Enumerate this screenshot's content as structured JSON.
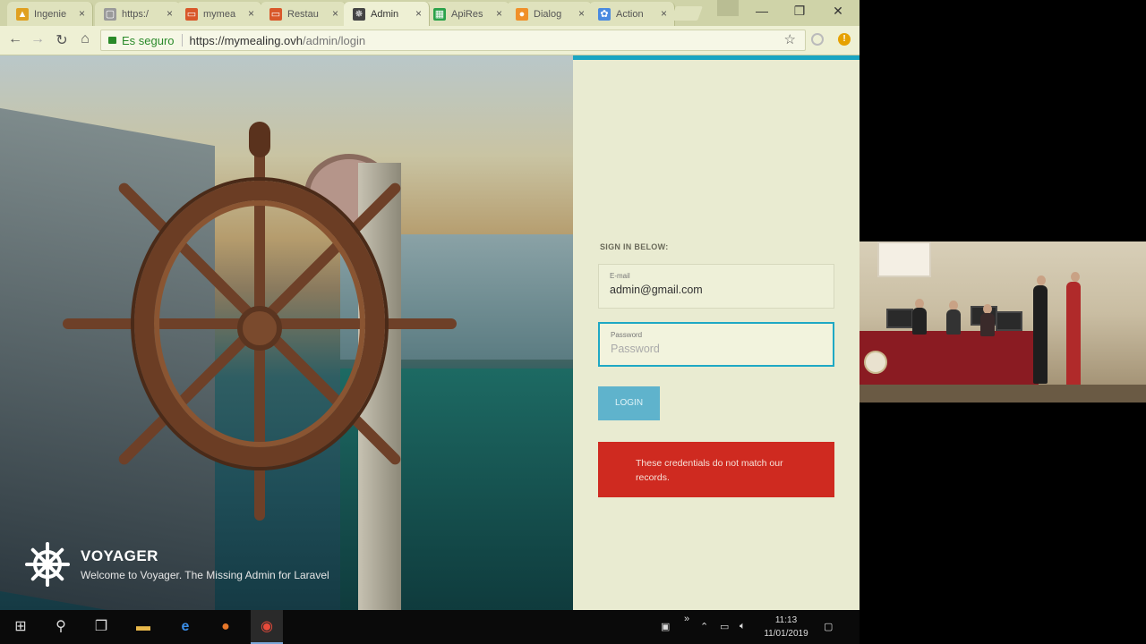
{
  "browser": {
    "tabs": [
      {
        "title": "Ingenie",
        "fav_color": "#e0a020",
        "fav_glyph": "▲"
      },
      {
        "title": "https:/",
        "fav_color": "#9a9a9a",
        "fav_glyph": "▢"
      },
      {
        "title": "mymea",
        "fav_color": "#d9582a",
        "fav_glyph": "▭"
      },
      {
        "title": "Restau",
        "fav_color": "#d9582a",
        "fav_glyph": "▭"
      },
      {
        "title": "Admin",
        "fav_color": "#444444",
        "fav_glyph": "✵"
      },
      {
        "title": "ApiRes",
        "fav_color": "#2aa24a",
        "fav_glyph": "▦"
      },
      {
        "title": "Dialog",
        "fav_color": "#f0902a",
        "fav_glyph": "●"
      },
      {
        "title": "Action",
        "fav_color": "#4a8ae0",
        "fav_glyph": "✿"
      }
    ],
    "active_tab_index": 4,
    "close_glyph": "×",
    "window": {
      "minimize": "—",
      "restore": "❐",
      "close": "✕"
    },
    "secure_label": "Es seguro",
    "url_prefix": "https://mymealing.ovh",
    "url_path": "/admin/login"
  },
  "hero": {
    "brand_title": "VOYAGER",
    "brand_subtitle": "Welcome to Voyager. The Missing Admin for Laravel"
  },
  "login": {
    "section_label": "SIGN IN BELOW:",
    "email_label": "E-mail",
    "email_value": "admin@gmail.com",
    "password_label": "Password",
    "password_placeholder": "Password",
    "submit_label": "LOGIN",
    "error_message": "These credentials do not match our records.",
    "accent_color": "#1aa5c2",
    "error_color": "#cf2a20"
  },
  "taskbar": {
    "time": "11:13",
    "date": "11/01/2019"
  }
}
